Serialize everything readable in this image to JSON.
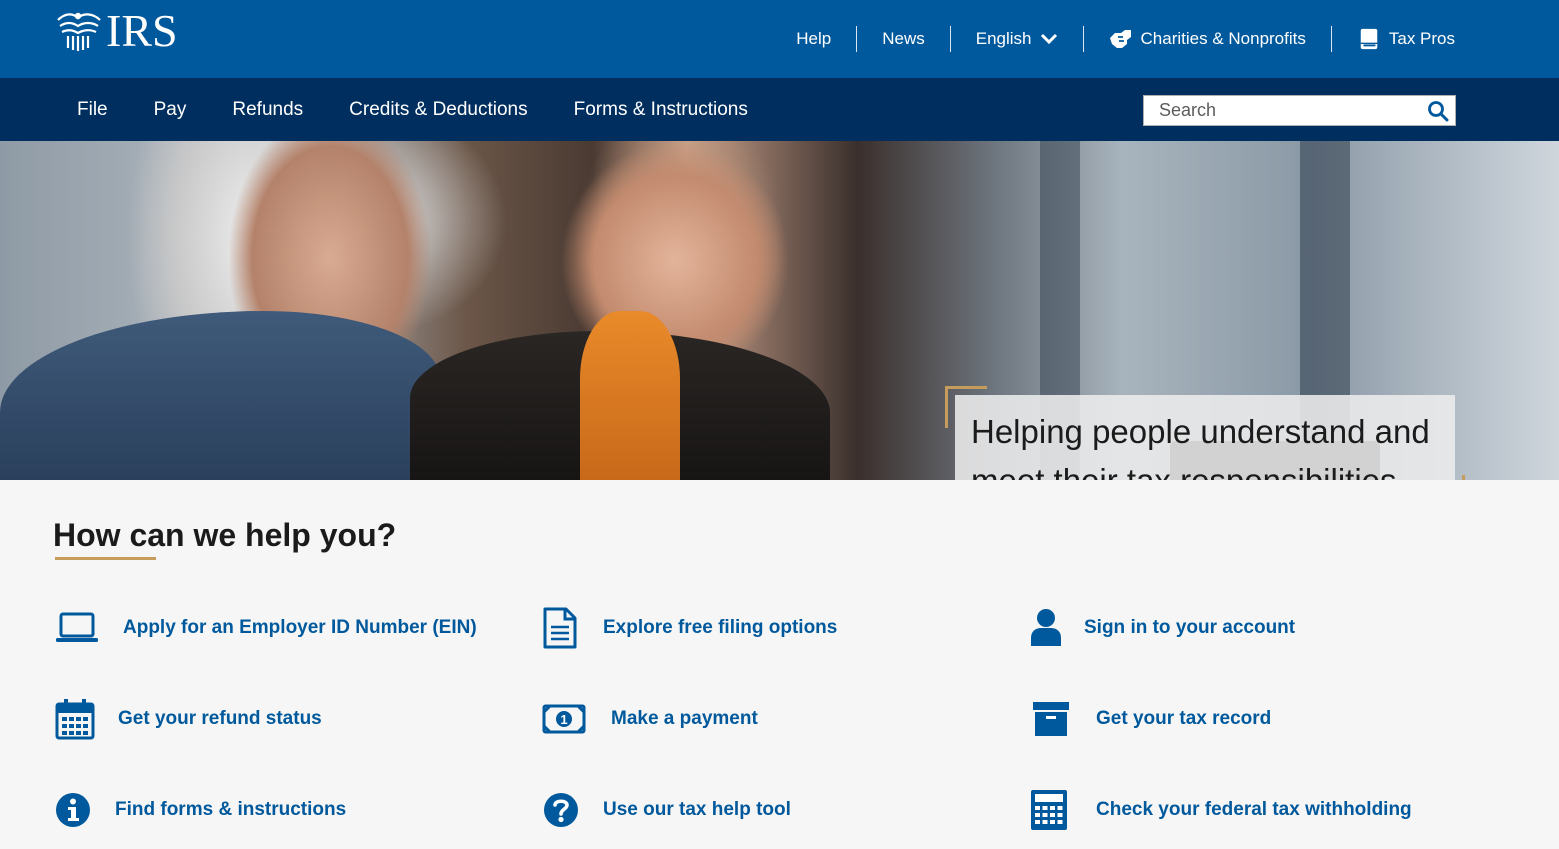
{
  "brand": {
    "logo_text": "IRS"
  },
  "utility_nav": {
    "help": "Help",
    "news": "News",
    "language": "English",
    "charities": "Charities & Nonprofits",
    "tax_pros": "Tax Pros"
  },
  "main_nav": {
    "items": [
      "File",
      "Pay",
      "Refunds",
      "Credits & Deductions",
      "Forms & Instructions"
    ]
  },
  "search": {
    "placeholder": "Search"
  },
  "hero": {
    "caption_line1": "Helping people understand and",
    "caption_line2": "meet their tax responsibilities"
  },
  "help_section": {
    "title": "How can we help you?",
    "tasks": [
      {
        "label": "Apply for an Employer ID Number (EIN)",
        "icon": "laptop-icon"
      },
      {
        "label": "Explore free filing options",
        "icon": "document-icon"
      },
      {
        "label": "Sign in to your account",
        "icon": "user-icon"
      },
      {
        "label": "Get your refund status",
        "icon": "calendar-icon"
      },
      {
        "label": "Make a payment",
        "icon": "money-icon"
      },
      {
        "label": "Get your tax record",
        "icon": "archive-box-icon"
      },
      {
        "label": "Find forms & instructions",
        "icon": "info-icon"
      },
      {
        "label": "Use our tax help tool",
        "icon": "question-icon"
      },
      {
        "label": "Check your federal tax withholding",
        "icon": "calculator-icon"
      }
    ]
  },
  "colors": {
    "top_bar": "#00599c",
    "main_nav": "#002f5f",
    "link_blue": "#00599c",
    "accent_gold": "#c69c5d"
  }
}
